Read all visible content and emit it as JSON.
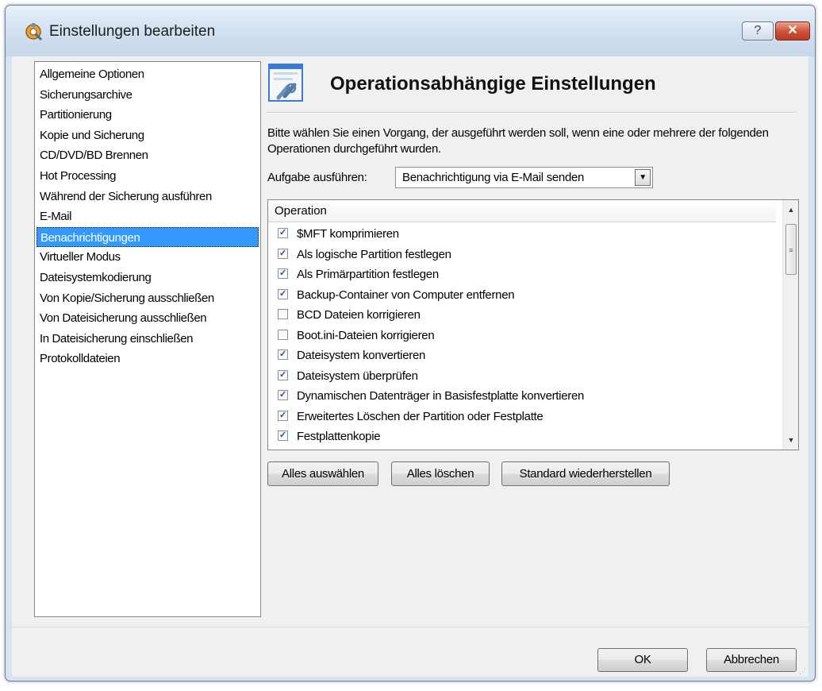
{
  "window": {
    "title": "Einstellungen bearbeiten",
    "help_label": "?",
    "close_label": "✕"
  },
  "nav": {
    "items": [
      "Allgemeine Optionen",
      "Sicherungsarchive",
      "Partitionierung",
      "Kopie und Sicherung",
      "CD/DVD/BD Brennen",
      "Hot Processing",
      "Während der Sicherung ausführen",
      "E-Mail",
      "Benachrichtigungen",
      "Virtueller Modus",
      "Dateisystemkodierung",
      "Von Kopie/Sicherung ausschließen",
      "Von Dateisicherung ausschließen",
      "In Dateisicherung einschließen",
      "Protokolldateien"
    ],
    "selected": "Benachrichtigungen"
  },
  "main": {
    "title": "Operationsabhängige Einstellungen",
    "description": "Bitte wählen Sie einen Vorgang, der ausgeführt werden soll, wenn eine oder mehrere der folgenden Operationen durchgeführt wurden.",
    "task_label": "Aufgabe ausführen:",
    "task_value": "Benachrichtigung via E-Mail senden",
    "list_header": "Operation",
    "operations": [
      {
        "label": "$MFT komprimieren",
        "checked": true
      },
      {
        "label": "Als logische Partition festlegen",
        "checked": true
      },
      {
        "label": "Als Primärpartition festlegen",
        "checked": true
      },
      {
        "label": "Backup-Container von Computer entfernen",
        "checked": true
      },
      {
        "label": "BCD Dateien korrigieren",
        "checked": false
      },
      {
        "label": "Boot.ini-Dateien korrigieren",
        "checked": false
      },
      {
        "label": "Dateisystem konvertieren",
        "checked": true
      },
      {
        "label": "Dateisystem überprüfen",
        "checked": true
      },
      {
        "label": "Dynamischen Datenträger in Basisfestplatte konvertieren",
        "checked": true
      },
      {
        "label": "Erweitertes Löschen der Partition oder Festplatte",
        "checked": true
      },
      {
        "label": "Festplattenkopie",
        "checked": true
      }
    ],
    "buttons": {
      "select_all": "Alles auswählen",
      "clear_all": "Alles löschen",
      "restore_defaults": "Standard wiederherstellen"
    }
  },
  "footer": {
    "ok": "OK",
    "cancel": "Abbrechen"
  },
  "icons": {
    "app": "gear-wrench-icon",
    "header": "document-link-icon",
    "checkmark": "checkmark-icon",
    "dropdown": "chevron-down-icon"
  },
  "colors": {
    "selection": "#3399ff",
    "title_bar": "#d4e2f1",
    "close_button": "#d0543a",
    "checkmark": "#2a4b9b"
  }
}
